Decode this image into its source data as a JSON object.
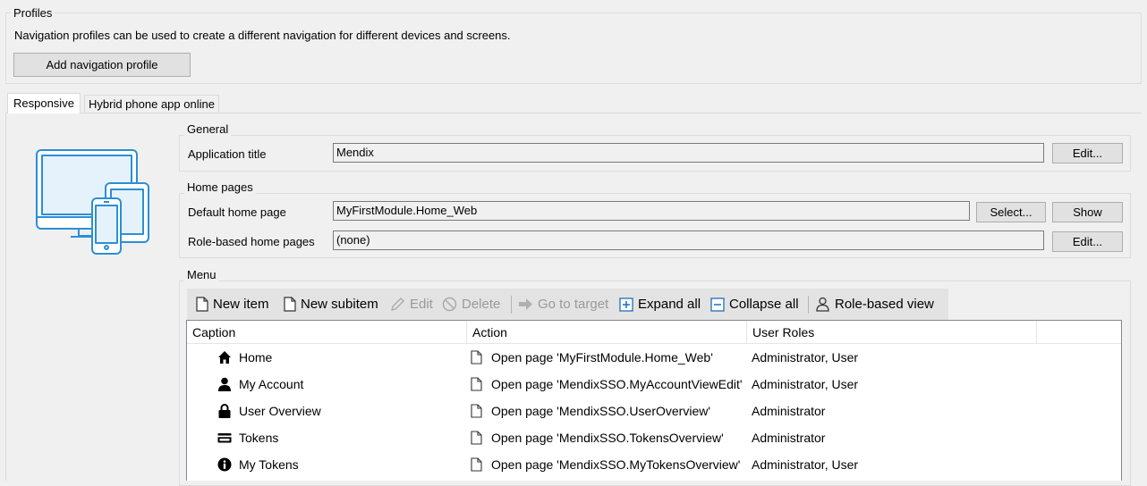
{
  "profiles": {
    "legend": "Profiles",
    "description": "Navigation profiles can be used to create a different navigation for different devices and screens.",
    "add_button": "Add navigation profile"
  },
  "tabs": [
    {
      "label": "Responsive",
      "active": true
    },
    {
      "label": "Hybrid phone app online",
      "active": false
    }
  ],
  "general": {
    "legend": "General",
    "app_title_label": "Application title",
    "app_title_value": "Mendix",
    "edit_button": "Edit..."
  },
  "home_pages": {
    "legend": "Home pages",
    "default_label": "Default home page",
    "default_value": "MyFirstModule.Home_Web",
    "select_button": "Select...",
    "show_button": "Show",
    "role_label": "Role-based home pages",
    "role_value": "(none)",
    "edit_button": "Edit..."
  },
  "menu": {
    "legend": "Menu",
    "toolbar": {
      "new_item": "New item",
      "new_subitem": "New subitem",
      "edit": "Edit",
      "delete": "Delete",
      "go_to_target": "Go to target",
      "expand_all": "Expand all",
      "collapse_all": "Collapse all",
      "role_based_view": "Role-based view"
    },
    "columns": [
      "Caption",
      "Action",
      "User Roles"
    ],
    "rows": [
      {
        "icon": "home-icon",
        "caption": "Home",
        "action": "Open page 'MyFirstModule.Home_Web'",
        "roles": "Administrator, User"
      },
      {
        "icon": "user-icon",
        "caption": "My Account",
        "action": "Open page 'MendixSSO.MyAccountViewEdit'",
        "roles": "Administrator, User"
      },
      {
        "icon": "lock-icon",
        "caption": "User Overview",
        "action": "Open page 'MendixSSO.UserOverview'",
        "roles": "Administrator"
      },
      {
        "icon": "card-icon",
        "caption": "Tokens",
        "action": "Open page 'MendixSSO.TokensOverview'",
        "roles": "Administrator"
      },
      {
        "icon": "info-icon",
        "caption": "My Tokens",
        "action": "Open page 'MendixSSO.MyTokensOverview'",
        "roles": "Administrator, User"
      }
    ]
  },
  "colors": {
    "device_illustration": "#2b8fd6",
    "toolbar_icon": "#1f6fb8"
  }
}
